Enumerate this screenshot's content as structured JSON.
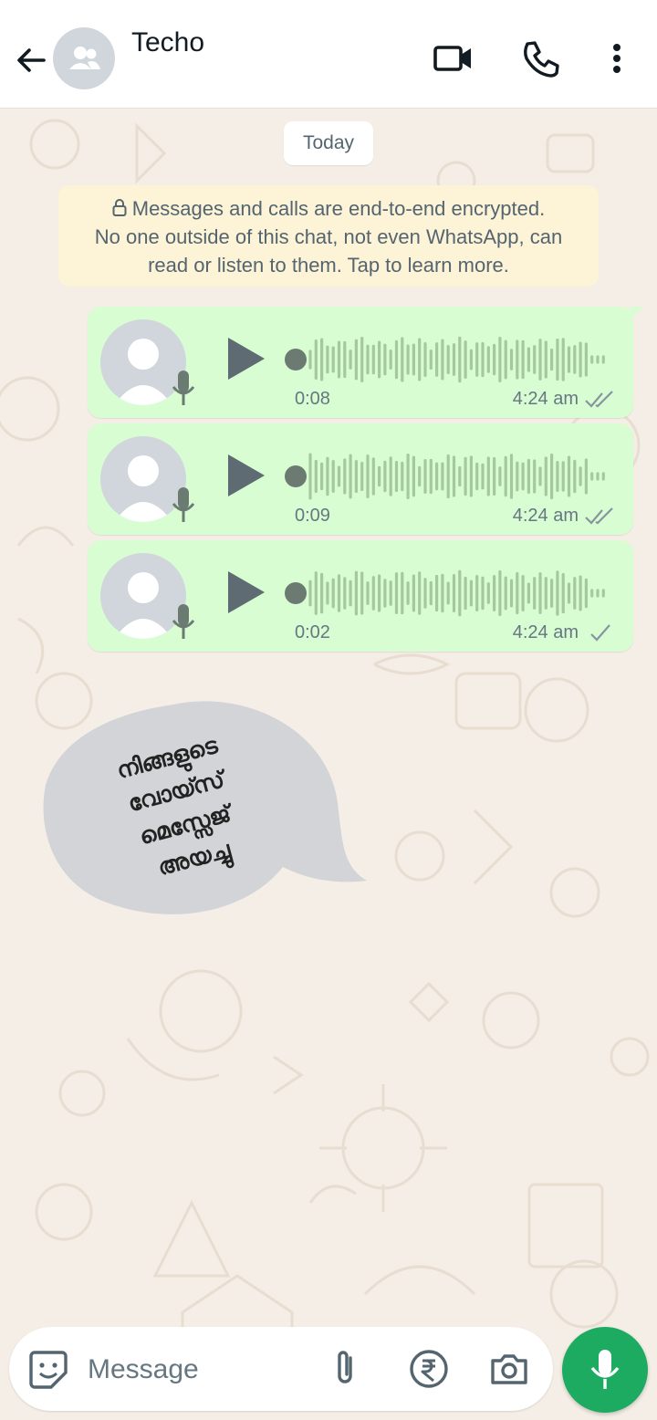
{
  "header": {
    "title": "Techo",
    "back_icon": "arrow-left-icon",
    "video_icon": "video-call-icon",
    "call_icon": "phone-icon",
    "menu_icon": "more-vert-icon"
  },
  "chat": {
    "date_label": "Today",
    "encryption_notice": {
      "line1": "Messages and calls are end-to-end encrypted.",
      "line2": "No one outside of this chat, not even WhatsApp, can",
      "line3": "read or listen to them. Tap to learn more."
    },
    "voice_messages": [
      {
        "duration": "0:08",
        "time": "4:24 am",
        "status": "read"
      },
      {
        "duration": "0:09",
        "time": "4:24 am",
        "status": "read"
      },
      {
        "duration": "0:02",
        "time": "4:24 am",
        "status": "sent"
      }
    ]
  },
  "overlay": {
    "line1": "നിങ്ങളുടെ",
    "line2": "വോയ്സ്",
    "line3": "മെസ്സേജ്",
    "line4": "അയച്ചു"
  },
  "composer": {
    "placeholder": "Message",
    "emoji_icon": "sticker-icon",
    "attach_icon": "paperclip-icon",
    "payment_icon": "rupee-icon",
    "camera_icon": "camera-icon",
    "mic_icon": "mic-icon"
  },
  "colors": {
    "bubble_out": "#d9fdd3",
    "accent": "#1daa61",
    "notice_bg": "#fdf3d7",
    "wallpaper": "#f4eee6"
  }
}
